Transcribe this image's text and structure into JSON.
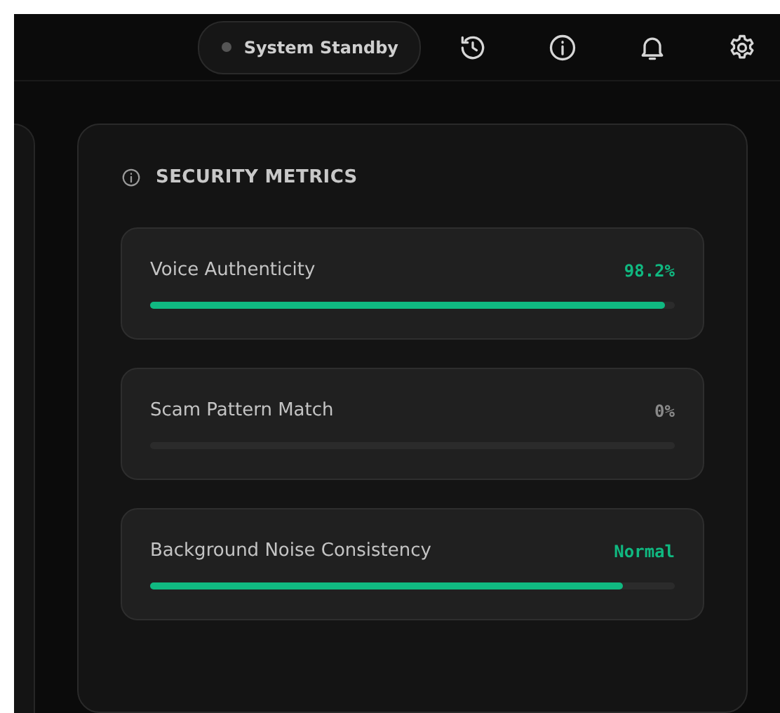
{
  "header": {
    "status": {
      "label": "System Standby",
      "active": false
    }
  },
  "panel": {
    "title": "SECURITY METRICS",
    "metrics": [
      {
        "name": "Voice Authenticity",
        "reading": "98.2%",
        "color": "#10b981",
        "level": 0.982
      },
      {
        "name": "Scam Pattern Match",
        "reading": "0%",
        "color": "#8a8a8a",
        "level": 0
      },
      {
        "name": "Background Noise Consistency",
        "reading": "Normal",
        "color": "#10b981",
        "level": 0.9
      }
    ]
  }
}
